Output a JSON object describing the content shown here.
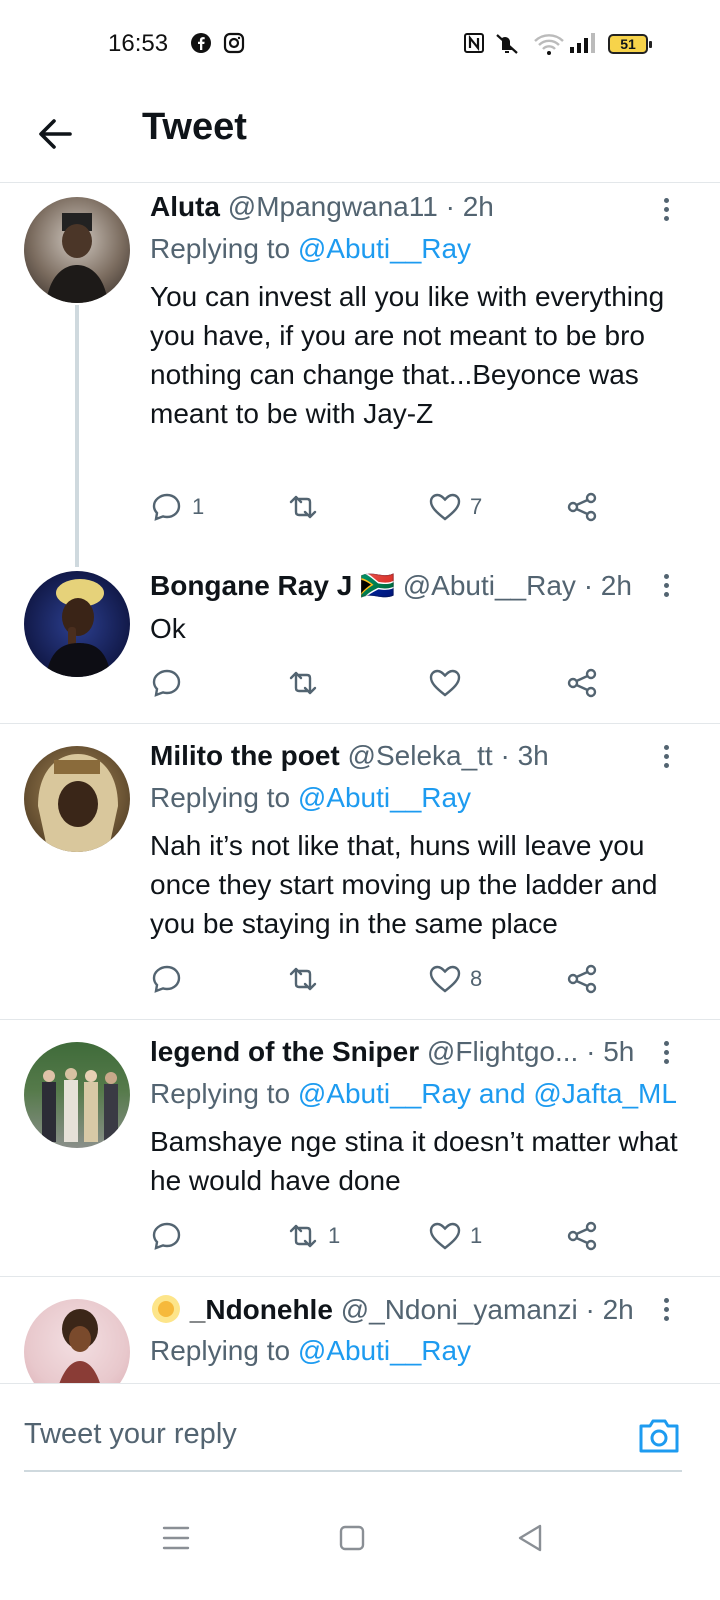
{
  "status_bar": {
    "time": "16:53",
    "battery": "51"
  },
  "header": {
    "title": "Tweet"
  },
  "tweets": [
    {
      "name": "Aluta",
      "handle": "@Mpangwana11",
      "dot": "·",
      "time": "2h",
      "replying_prefix": "Replying to",
      "replying_to": "@Abuti__Ray",
      "text": "You can invest all you like with everything you have, if you are not meant to be bro nothing can change that...Beyonce was meant to be with Jay-Z",
      "reply_count": "1",
      "retweet_count": "",
      "like_count": "7"
    },
    {
      "name": "Bongane Ray J",
      "flag": "🇿🇦",
      "handle": "@Abuti__Ray",
      "dot": "·",
      "time": "2h",
      "text": "Ok",
      "reply_count": "",
      "retweet_count": "",
      "like_count": ""
    },
    {
      "name": "Milito the poet",
      "handle": "@Seleka_tt",
      "dot": "·",
      "time": "3h",
      "replying_prefix": "Replying to",
      "replying_to": "@Abuti__Ray",
      "text": "Nah it’s not like that, huns will leave you once they start moving up the ladder and you be staying in the same place",
      "reply_count": "",
      "retweet_count": "",
      "like_count": "8"
    },
    {
      "name": "legend of the Sniper",
      "handle": "@Flightgo...",
      "dot": "·",
      "time": "5h",
      "replying_prefix": "Replying to",
      "replying_to": "@Abuti__Ray and @Jafta_ML",
      "text": "Bamshaye nge stina it doesn’t matter what he would have done",
      "reply_count": "",
      "retweet_count": "1",
      "like_count": "1"
    },
    {
      "name": "_Ndonehle",
      "handle": "@_Ndoni_yamanzi",
      "dot": "·",
      "time": "2h",
      "replying_prefix": "Replying to",
      "replying_to": "@Abuti__Ray"
    }
  ],
  "reply_bar": {
    "placeholder": "Tweet your reply"
  },
  "icons": [
    "back-arrow-icon",
    "more-icon",
    "reply-icon",
    "retweet-icon",
    "like-icon",
    "share-icon",
    "camera-icon",
    "menu-icon",
    "home-icon",
    "back-nav-icon"
  ],
  "colors": {
    "link": "#1d9bf0",
    "secondary": "#536471",
    "text": "#0f1419"
  }
}
